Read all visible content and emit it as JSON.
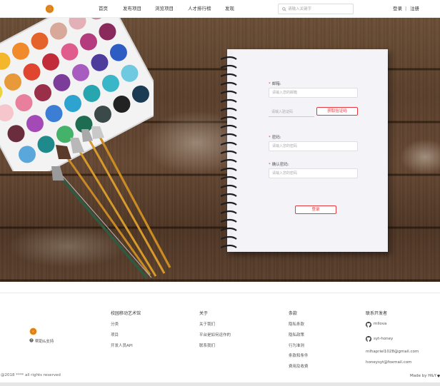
{
  "header": {
    "nav": [
      "首页",
      "发布项目",
      "浏览项目",
      "人才排行榜",
      "发现"
    ],
    "search_placeholder": "请输入关键字",
    "login": "登录",
    "separator": "|",
    "register": "注册"
  },
  "form": {
    "email_label": "邮箱:",
    "email_placeholder": "请输入您的邮箱",
    "code_placeholder": "请输入验证码",
    "get_code_button": "获取验证码",
    "password_label": "密码:",
    "password_placeholder": "请输入您的密码",
    "confirm_label": "确认密码:",
    "confirm_placeholder": "请输入您的密码",
    "submit_button": "登录"
  },
  "footer": {
    "help": "帮助&支持",
    "col1": {
      "title": "校园移动艺术馆",
      "items": [
        "分类",
        "项目",
        "开发人员API"
      ]
    },
    "col2": {
      "title": "关于",
      "items": [
        "关于我们",
        "平台是如何运作的",
        "联系我们"
      ]
    },
    "col3": {
      "title": "条款",
      "items": [
        "隐私条款",
        "隐私政策",
        "行为准则",
        "条款和条件",
        "费用及收费"
      ]
    },
    "col4": {
      "title": "联系开发者",
      "github1": "mllova",
      "github2": "syt-honey",
      "email1": "mlhapriel1028@gmail.com",
      "email2": "honeysyt@foxmail.com"
    },
    "copyright": "@2018 **** all rights reserved",
    "made_by": "Made by H&Y"
  },
  "colors": {
    "accent_red": "#e8383d",
    "wood": "#5a3f2b"
  }
}
